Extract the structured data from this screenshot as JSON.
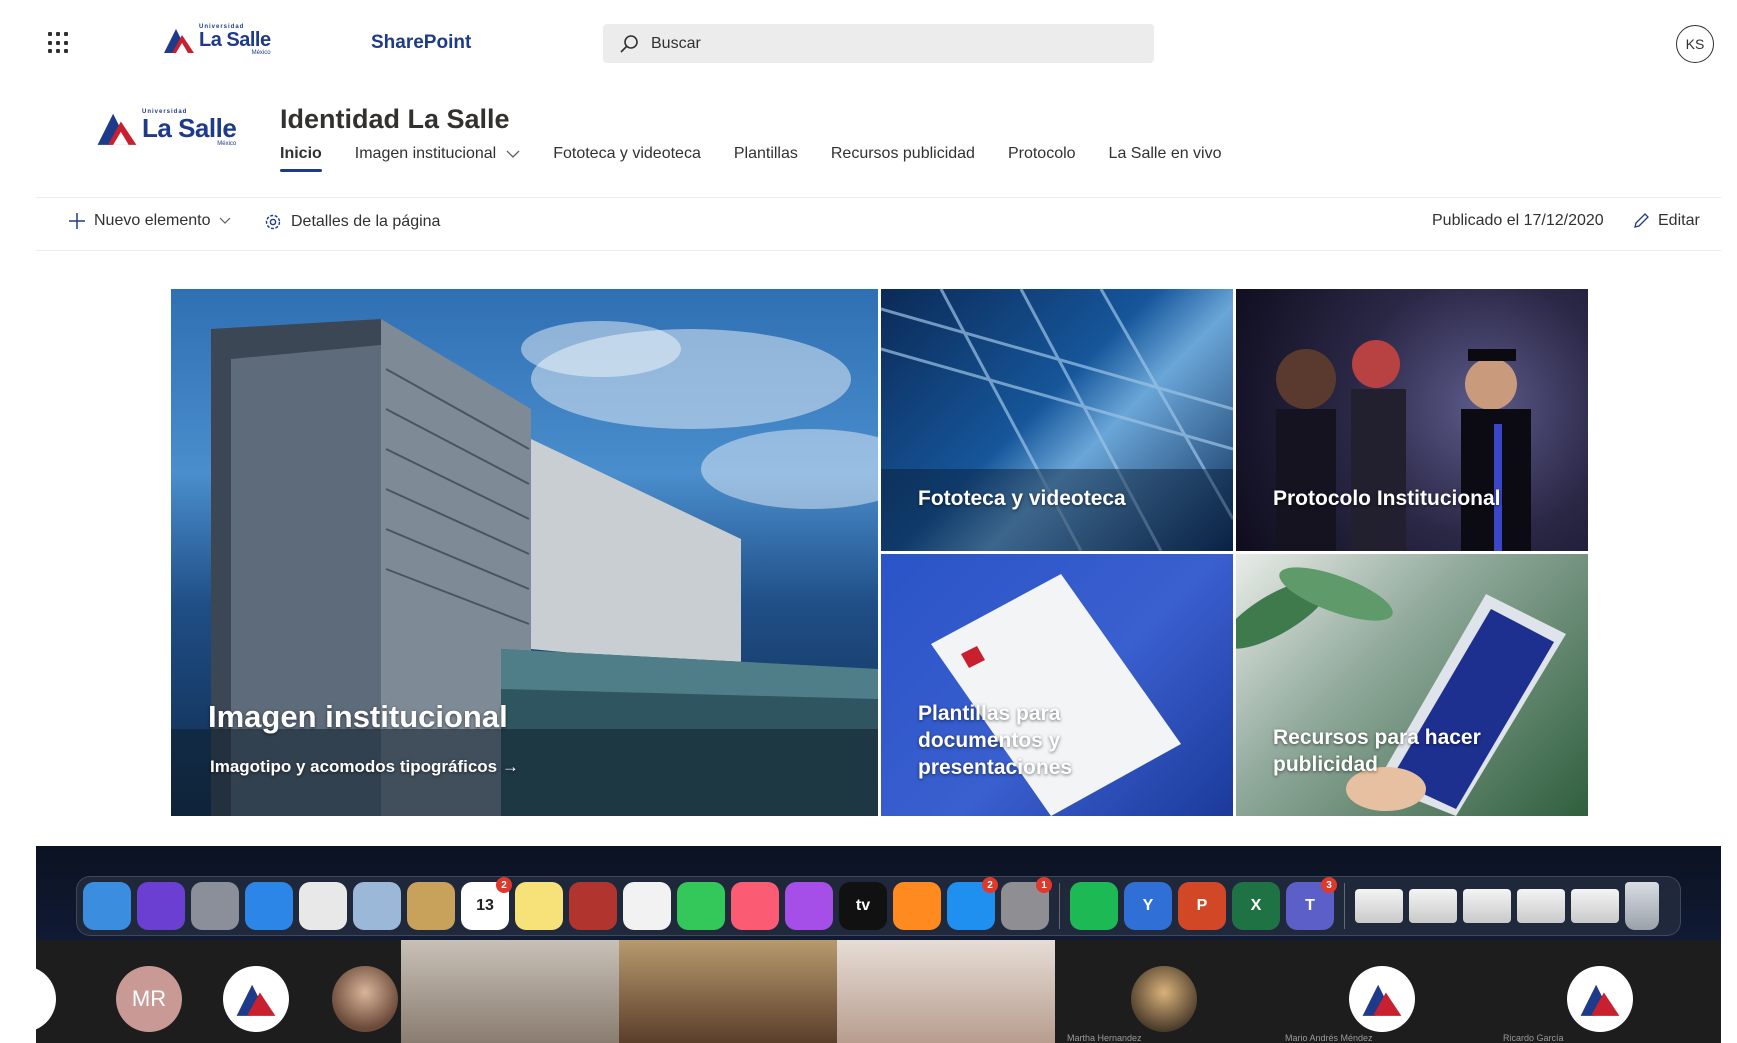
{
  "suite": {
    "app_name": "SharePoint",
    "search_placeholder": "Buscar",
    "user_initials": "KS",
    "logo": {
      "top": "Universidad",
      "name": "La Salle",
      "sub": "México"
    }
  },
  "site": {
    "title": "Identidad La Salle",
    "logo": {
      "top": "Universidad",
      "name": "La Salle",
      "sub": "México"
    },
    "nav": [
      {
        "label": "Inicio",
        "active": true,
        "dropdown": false
      },
      {
        "label": "Imagen institucional",
        "active": false,
        "dropdown": true
      },
      {
        "label": "Fototeca y videoteca",
        "active": false,
        "dropdown": false
      },
      {
        "label": "Plantillas",
        "active": false,
        "dropdown": false
      },
      {
        "label": "Recursos publicidad",
        "active": false,
        "dropdown": false
      },
      {
        "label": "Protocolo",
        "active": false,
        "dropdown": false
      },
      {
        "label": "La Salle en vivo",
        "active": false,
        "dropdown": false
      }
    ]
  },
  "command_bar": {
    "new_item": "Nuevo elemento",
    "page_details": "Detalles de la página",
    "published": "Publicado el 17/12/2020",
    "edit": "Editar"
  },
  "hero": {
    "main": {
      "title": "Imagen institucional",
      "subtitle": "Imagotipo y acomodos tipográficos →"
    },
    "tiles": [
      "Fototeca y videoteca",
      "Protocolo Institucional",
      "Plantillas para documentos y presentaciones",
      "Recursos para hacer publicidad"
    ]
  },
  "dock": {
    "apps": [
      {
        "icon": "finder-icon",
        "color": "#3b8de0"
      },
      {
        "icon": "siri-icon",
        "color": "#6a3fd1"
      },
      {
        "icon": "launchpad-icon",
        "color": "#8a8f99"
      },
      {
        "icon": "safari-icon",
        "color": "#2c86e8"
      },
      {
        "icon": "chrome-icon",
        "color": "#e8e8e8"
      },
      {
        "icon": "preview-icon",
        "color": "#9bb8d8"
      },
      {
        "icon": "notes-folder-icon",
        "color": "#c8a25a"
      },
      {
        "icon": "calendar-icon",
        "color": "#ffffff",
        "text": "13",
        "badge": "2"
      },
      {
        "icon": "notes-icon",
        "color": "#f7e27a"
      },
      {
        "icon": "photo-booth-icon",
        "color": "#b2342f"
      },
      {
        "icon": "photos-icon",
        "color": "#f2f2f2"
      },
      {
        "icon": "facetime-icon",
        "color": "#34c759"
      },
      {
        "icon": "music-icon",
        "color": "#fb5c74"
      },
      {
        "icon": "podcasts-icon",
        "color": "#a64ee8"
      },
      {
        "icon": "tv-icon",
        "color": "#111111",
        "text": "tv"
      },
      {
        "icon": "books-icon",
        "color": "#ff8a1f"
      },
      {
        "icon": "app-store-icon",
        "color": "#1f8ff0",
        "badge": "2"
      },
      {
        "icon": "system-preferences-icon",
        "color": "#8e8e93",
        "badge": "1"
      },
      {
        "icon": "spotify-icon",
        "color": "#1db954"
      },
      {
        "icon": "yammer-icon",
        "color": "#2f6fd6",
        "text": "Y"
      },
      {
        "icon": "powerpoint-icon",
        "color": "#d24726",
        "text": "P"
      },
      {
        "icon": "excel-icon",
        "color": "#1f7244",
        "text": "X"
      },
      {
        "icon": "teams-icon",
        "color": "#5b5fc7",
        "text": "T",
        "badge": "3"
      }
    ],
    "recents": [
      "recent-window-1",
      "recent-window-2",
      "recent-window-3",
      "recent-window-4",
      "recent-window-5"
    ]
  },
  "participants": [
    {
      "initials": "MR",
      "name": ""
    },
    {
      "name": "Martha Hernandez"
    },
    {
      "name": "Mario Andrés Méndez"
    },
    {
      "name": "Ricardo García"
    }
  ]
}
